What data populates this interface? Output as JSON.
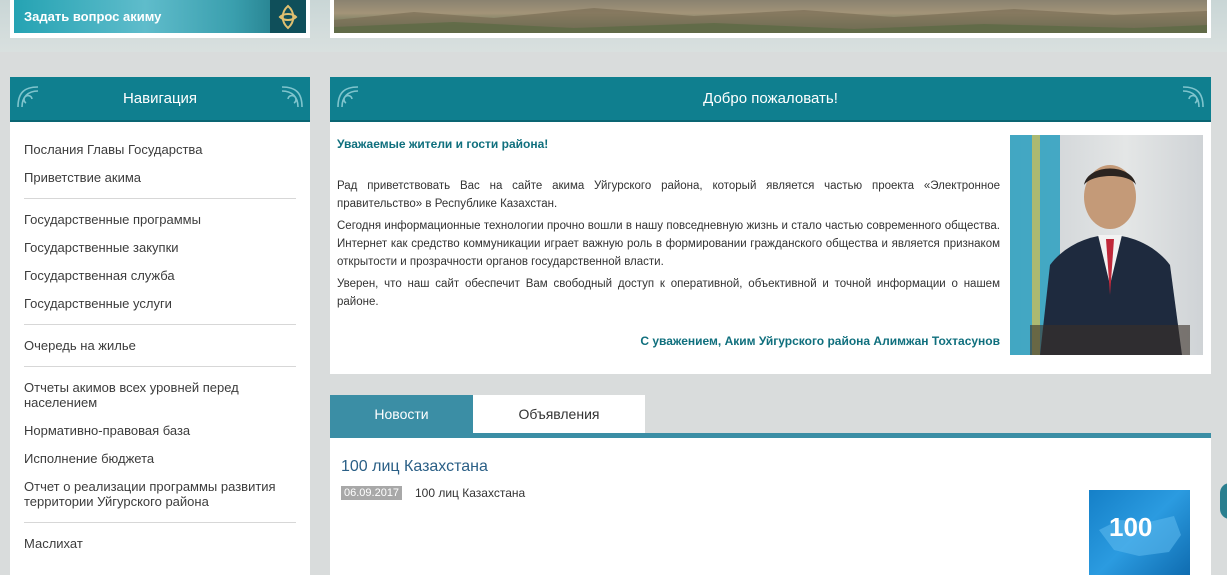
{
  "top": {
    "ask_akim_label": "Задать вопрос акиму"
  },
  "sidebar": {
    "title": "Навигация",
    "groups": [
      [
        "Послания Главы Государства",
        "Приветствие акима"
      ],
      [
        "Государственные программы",
        "Государственные закупки",
        "Государственная служба",
        "Государственные услуги"
      ],
      [
        "Очередь на жилье"
      ],
      [
        "Отчеты акимов всех уровней перед населением",
        "Нормативно-правовая база",
        "Исполнение бюджета",
        "Отчет о реализации программы развития территории Уйгурского района"
      ],
      [
        "Маслихат"
      ]
    ]
  },
  "welcome": {
    "title": "Добро пожаловать!",
    "greeting": "Уважаемые жители и гости района!",
    "paragraphs": [
      "Рад приветствовать Вас на сайте акима Уйгурского района, который является частью проекта «Электронное правительство» в Республике Казахстан.",
      "Сегодня информационные технологии прочно вошли в нашу повседневную жизнь и стало частью современного общества. Интернет как средство коммуникации играет важную роль в формировании гражданского общества и является признаком открытости и прозрачности органов государственной власти.",
      "Уверен, что наш сайт обеспечит Вам свободный доступ к оперативной, объективной и точной информации о нашем районе."
    ],
    "signature": "С уважением, Аким Уйгурского района Алимжан Тохтасунов"
  },
  "tabs": {
    "news_label": "Новости",
    "ads_label": "Объявления"
  },
  "news": {
    "title": "100 лиц Казахстана",
    "date": "06.09.2017",
    "summary": "100 лиц Казахстана",
    "image_text": "100"
  },
  "colors": {
    "header_teal": "#0f7f8f",
    "tab_active": "#3b8ea5",
    "accent_text": "#0f6f7d"
  }
}
